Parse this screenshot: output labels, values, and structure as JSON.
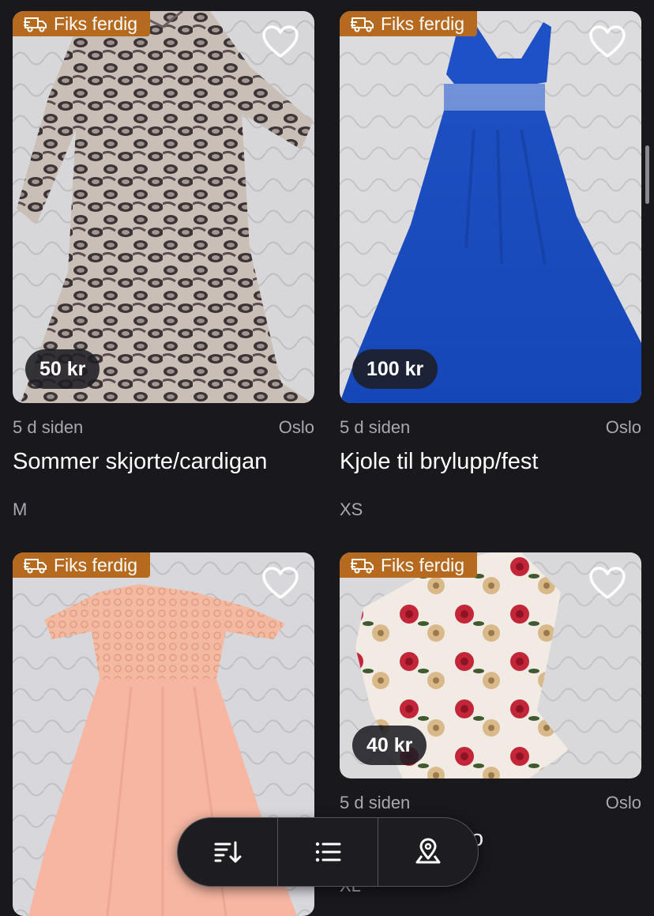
{
  "listings": [
    {
      "badge": "Fiks ferdig",
      "price": "50 kr",
      "age": "5 d siden",
      "location": "Oslo",
      "title": "Sommer skjorte/cardigan",
      "size": "M"
    },
    {
      "badge": "Fiks ferdig",
      "price": "100 kr",
      "age": "5 d siden",
      "location": "Oslo",
      "title": "Kjole til brylupp/fest",
      "size": "XS"
    },
    {
      "badge": "Fiks ferdig"
    },
    {
      "badge": "Fiks ferdig",
      "price": "40 kr",
      "age": "5 d siden",
      "location": "Oslo",
      "title_partial": "o",
      "size": "XL"
    }
  ],
  "toolbar": {
    "icons": [
      "sort-icon",
      "list-view-icon",
      "map-pin-icon"
    ]
  },
  "colors": {
    "background": "#18181d",
    "badge": "#b66a1f"
  }
}
